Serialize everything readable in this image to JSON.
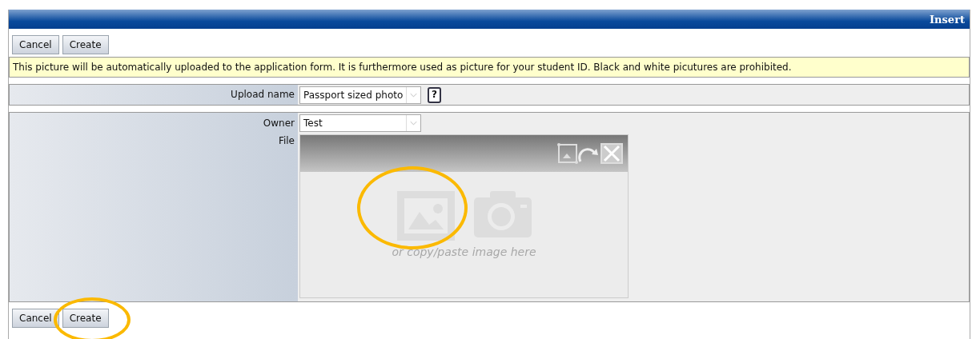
{
  "window": {
    "title": "Insert"
  },
  "top_buttons": [
    "Cancel",
    "Create"
  ],
  "notice": "This picture will be automatically uploaded to the application form. It is furthermore used as picture for your student ID. Black and white picutures are prohibited.",
  "upload_name": {
    "label": "Upload name",
    "value": "Passport sized photo",
    "help": "?"
  },
  "owner": {
    "label": "Owner",
    "value": "Test"
  },
  "file": {
    "label": "File",
    "drop_hint": "or copy/paste image here"
  },
  "bottom_buttons": [
    "Cancel",
    "Create"
  ]
}
